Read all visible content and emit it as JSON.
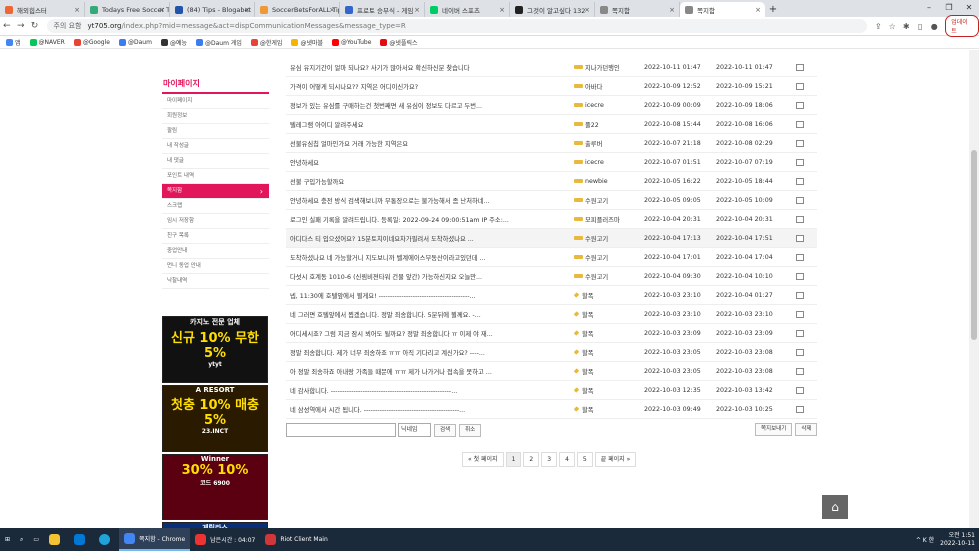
{
  "browser": {
    "tabs": [
      {
        "label": "해외힙스터",
        "color": "#e63"
      },
      {
        "label": "Todays Free Soccer T",
        "color": "#3a7"
      },
      {
        "label": "(84) Tips - Blogabet",
        "color": "#25a"
      },
      {
        "label": "SoccerBetsForALL Tip",
        "color": "#e93"
      },
      {
        "label": "프로토 승부식 - 게임",
        "color": "#36c"
      },
      {
        "label": "네이버 스포츠",
        "color": "#0c6"
      },
      {
        "label": "그것이 알고싶다 132",
        "color": "#222"
      },
      {
        "label": "쪽지함",
        "color": "#888"
      },
      {
        "label": "쪽지함",
        "color": "#888"
      }
    ],
    "window_controls": [
      "–",
      "❐",
      "✕"
    ],
    "warning": "주의 요함",
    "url_host": "yt705.org",
    "url_path": "/index.php?mid=message&act=dispCommunicationMessages&message_type=R",
    "update_label": "업데이트"
  },
  "bookmarks": [
    {
      "label": "앱",
      "color": "#4285f4"
    },
    {
      "label": "@NAVER",
      "color": "#03c75a"
    },
    {
      "label": "@Google",
      "color": "#ea4335"
    },
    {
      "label": "@Daum",
      "color": "#3b7cf3"
    },
    {
      "label": "@예능",
      "color": "#333"
    },
    {
      "label": "@Daum 게임",
      "color": "#3b7cf3"
    },
    {
      "label": "@한게임",
      "color": "#ea4335"
    },
    {
      "label": "@넷마블",
      "color": "#f5b400"
    },
    {
      "label": "@YouTube",
      "color": "#ff0000"
    },
    {
      "label": "@넷플릭스",
      "color": "#e50914"
    }
  ],
  "sidebar": {
    "title": "마이페이지",
    "items": [
      "마이페이지",
      "회원정보",
      "팔림",
      "내 작성글",
      "내 댓글",
      "포인트 내역",
      "쪽지함",
      "스크랩",
      "임시 저장함",
      "친구 목록",
      "중업안내",
      "먼니 동업 안내",
      "낙찰내역"
    ],
    "active_index": 6
  },
  "banners": [
    {
      "l1": "카지노 전문 업체",
      "l2": "신규 10% 무한 5%",
      "l3": "ytyt"
    },
    {
      "l1": "A RESORT",
      "l2": "첫충 10% 매충 5%",
      "l3": "23.INCT"
    },
    {
      "l1": "Winner",
      "l2": "30% 10%",
      "l3": "코드 6900"
    },
    {
      "l1": "게릴라스",
      "l2": "",
      "l3": ""
    }
  ],
  "messages": [
    {
      "title": "유심 유지기간이 얼마 되나요? 사기가 많아서요 확신하신분 찾습니다",
      "author": "지나가던행인",
      "sent": "2022-10-11 01:47",
      "read": "2022-10-11 01:47",
      "icon": "bar"
    },
    {
      "title": "가격이 어떻게 되시나요?? 지역은 어디이신가요?",
      "author": "아바다",
      "sent": "2022-10-09 12:52",
      "read": "2022-10-09 15:21",
      "icon": "bar"
    },
    {
      "title": "정보가 있는 유심를 구매하는건 첫번째면 새 유심이 정보도 다르고 두번...",
      "author": "icecre",
      "sent": "2022-10-09 00:09",
      "read": "2022-10-09 18:06",
      "icon": "bar"
    },
    {
      "title": "텔레그램 아이디 알려주세요",
      "author": "풀22",
      "sent": "2022-10-08 15:44",
      "read": "2022-10-08 16:06",
      "icon": "bar"
    },
    {
      "title": "선불유심칩 얼마인가요 거래 가능한 지역은요",
      "author": "출루버",
      "sent": "2022-10-07 21:18",
      "read": "2022-10-08 02:29",
      "icon": "bar"
    },
    {
      "title": "안녕하세요",
      "author": "icecre",
      "sent": "2022-10-07 01:51",
      "read": "2022-10-07 07:19",
      "icon": "bar"
    },
    {
      "title": "선불 구입가능할까요",
      "author": "newbie",
      "sent": "2022-10-05 16:22",
      "read": "2022-10-05 18:44",
      "icon": "bar"
    },
    {
      "title": "안녕하세요 충전 방식 검색해보니까 무통장으로는 불가능해서 좀 난처하네...",
      "author": "수원고기",
      "sent": "2022-10-05 09:05",
      "read": "2022-10-05 10:09",
      "icon": "bar"
    },
    {
      "title": "로그인 실패 기록을 알려드립니다. 등록일: 2022-09-24 09:00:51am IP 주소:...",
      "author": "모피플러즈마",
      "sent": "2022-10-04 20:31",
      "read": "2022-10-04 20:31",
      "icon": "bar"
    },
    {
      "title": "아디다스 티 입으셨어요? 15분토치이네요차가필려서 도착하셨나요 ...",
      "author": "수원고기",
      "sent": "2022-10-04 17:13",
      "read": "2022-10-04 17:51",
      "icon": "bar"
    },
    {
      "title": "도착하셨나요 네 가능할거니 지도보니까 벨계에이스부동산이라고있던데 ...",
      "author": "수원고기",
      "sent": "2022-10-04 17:01",
      "read": "2022-10-04 17:04",
      "icon": "bar"
    },
    {
      "title": "다섯시 호계동 1010-6 (신림비젼타워 건물 앞간) 가능하신지요 오늘만...",
      "author": "수원고기",
      "sent": "2022-10-04 09:30",
      "read": "2022-10-04 10:10",
      "icon": "bar"
    },
    {
      "title": "넵, 11:30에 호텔앞에서 뵐게요! ----------------------------------------...",
      "author": "할폭",
      "sent": "2022-10-03 23:10",
      "read": "2022-10-04 01:27",
      "icon": "dia"
    },
    {
      "title": "네 그러면 호텔앞에서 뵙겠습니다. 정말 죄송합니다. 5분뒤에 뵐께요. -...",
      "author": "할폭",
      "sent": "2022-10-03 23:10",
      "read": "2022-10-03 23:10",
      "icon": "dia"
    },
    {
      "title": "어디세시죠? 그럼 지금 잠시 뵈어도 될까요? 정말 죄송합니다 ㅠ 이제 야 재...",
      "author": "할폭",
      "sent": "2022-10-03 23:09",
      "read": "2022-10-03 23:09",
      "icon": "dia"
    },
    {
      "title": "정말 죄송합니다. 제가 너무 죄송하죠 ㅠㅠ 아직 기다리고 계신가요? ----...",
      "author": "할폭",
      "sent": "2022-10-03 23:05",
      "read": "2022-10-03 23:08",
      "icon": "dia"
    },
    {
      "title": "아 정말 죄송하죠 아내랑 가족들 때문에 ㅠㅠ 제가 나가거나 접속을 못하고 ...",
      "author": "할폭",
      "sent": "2022-10-03 23:05",
      "read": "2022-10-03 23:08",
      "icon": "dia"
    },
    {
      "title": "네 감사합니다. -----------------------------------------------------...",
      "author": "할폭",
      "sent": "2022-10-03 12:35",
      "read": "2022-10-03 13:42",
      "icon": "dia"
    },
    {
      "title": "네 삼성역에서 시간 됩니다. ------------------------------------------...",
      "author": "할폭",
      "sent": "2022-10-03 09:49",
      "read": "2022-10-03 10:25",
      "icon": "dia"
    }
  ],
  "search": {
    "select_value": "닉네임",
    "search_label": "검색",
    "cancel_label": "취소"
  },
  "actions": {
    "view_all": "쪽지보내기",
    "delete": "삭제"
  },
  "pager": {
    "first": "« 첫 페이지",
    "pages": [
      "1",
      "2",
      "3",
      "4",
      "5"
    ],
    "current": "1",
    "last": "끝 페이지 »"
  },
  "totop": "⌂",
  "taskbar": {
    "items": [
      {
        "label": "쪽지함 - Chrome",
        "color": "#4285f4",
        "on": true
      },
      {
        "label": "남은시간 : 04:07",
        "color": "#e33",
        "on": false
      },
      {
        "label": "Riot Client Main",
        "color": "#d13639",
        "on": false
      }
    ],
    "tray": "^ K 한",
    "time": "오전 1:51",
    "date": "2022-10-11"
  }
}
